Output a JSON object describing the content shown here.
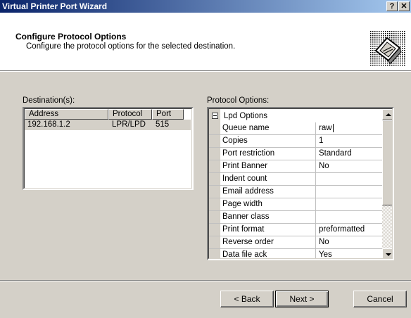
{
  "window": {
    "title": "Virtual Printer Port Wizard",
    "help_glyph": "?",
    "close_glyph": "✕"
  },
  "header": {
    "title": "Configure Protocol Options",
    "subtitle": "Configure the protocol options for the selected destination."
  },
  "destinations": {
    "label": "Destination(s):",
    "columns": [
      "Address",
      "Protocol",
      "Port"
    ],
    "rows": [
      {
        "address": "192.168.1.2",
        "protocol": "LPR/LPD",
        "port": "515"
      }
    ]
  },
  "protocol_options": {
    "label": "Protocol Options:",
    "group_name": "Lpd Options",
    "properties": [
      {
        "name": "Queue name",
        "value": "raw"
      },
      {
        "name": "Copies",
        "value": "1"
      },
      {
        "name": "Port restriction",
        "value": "Standard"
      },
      {
        "name": "Print Banner",
        "value": "No"
      },
      {
        "name": "Indent count",
        "value": ""
      },
      {
        "name": "Email address",
        "value": ""
      },
      {
        "name": "Page width",
        "value": ""
      },
      {
        "name": "Banner class",
        "value": ""
      },
      {
        "name": "Print format",
        "value": "preformatted"
      },
      {
        "name": "Reverse order",
        "value": "No"
      },
      {
        "name": "Data file ack",
        "value": "Yes"
      }
    ]
  },
  "buttons": {
    "back": "< Back",
    "next": "Next >",
    "cancel": "Cancel"
  }
}
